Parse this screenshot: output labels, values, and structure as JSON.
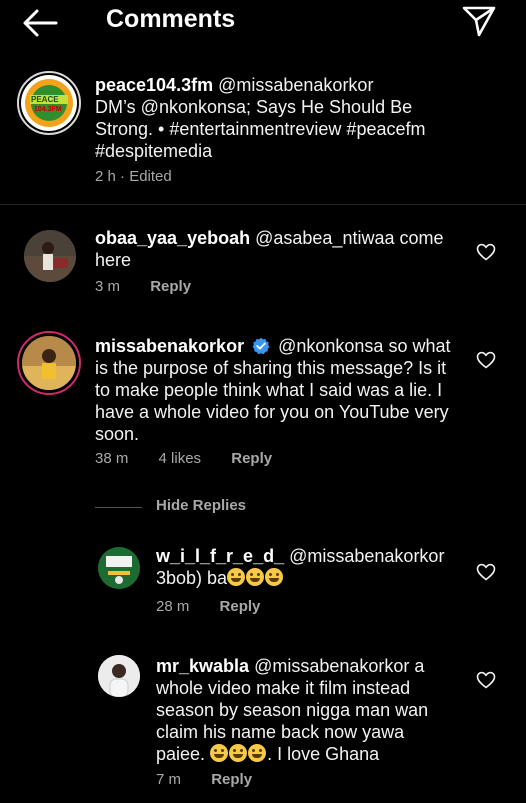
{
  "header": {
    "title": "Comments"
  },
  "caption": {
    "username": "peace104.3fm",
    "mention": "@missabenakorkor",
    "line2": "DM’s @nkonkonsa; Says He Should Be",
    "line3": "Strong. • #entertainmentreview #peacefm",
    "line4": "#despitemedia",
    "time": "2 h",
    "edited": "Edited",
    "logo_text_top": "PEACE",
    "logo_text_bottom": "104.3FM"
  },
  "comments": [
    {
      "username": "obaa_yaa_yeboah",
      "line1": "@asabea_ntiwaa come",
      "line2": "here",
      "time": "3 m",
      "reply": "Reply"
    },
    {
      "username": "missabenakorkor",
      "line1": "@nkonkonsa so what",
      "line2": "is the purpose of sharing this message? Is it",
      "line3": "to make people think what I said was a lie. I",
      "line4": "have a whole video for you on YouTube very",
      "line5": "soon.",
      "time": "38 m",
      "likes": "4 likes",
      "reply": "Reply"
    }
  ],
  "hide_replies": "Hide Replies",
  "replies": [
    {
      "username": "w_i_l_f_r_e_d_",
      "line1": "@missabenakorkor",
      "line2": "3bob) ba",
      "time": "28 m",
      "reply": "Reply"
    },
    {
      "username": "mr_kwabla",
      "line1": "@missabenakorkor a",
      "line2": "whole video make it film instead",
      "line3": "season by season nigga man wan",
      "line4": "claim his name back now yawa",
      "line5": "paiee.",
      "line5_end": ". I love Ghana",
      "time": "7 m",
      "reply": "Reply"
    }
  ],
  "colors": {
    "background": "#000000",
    "verified": "#3897f0",
    "story_ring": "#e1306c",
    "meta": "#a8a8a8"
  }
}
